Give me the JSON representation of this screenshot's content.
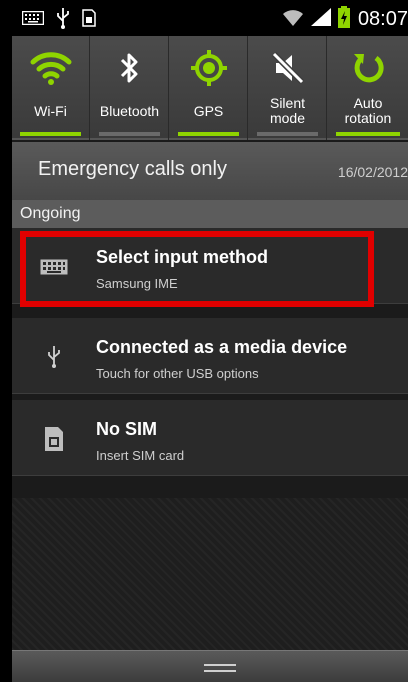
{
  "status_bar": {
    "time": "08:07",
    "left_icons": [
      "keyboard-icon",
      "usb-icon",
      "sim-icon"
    ],
    "right_icons": [
      "wifi-signal-icon",
      "cell-signal-icon",
      "battery-charging-icon"
    ]
  },
  "quick_settings": [
    {
      "label": "Wi-Fi",
      "icon": "wifi-icon",
      "active": true
    },
    {
      "label": "Bluetooth",
      "icon": "bluetooth-icon",
      "active": false
    },
    {
      "label": "GPS",
      "icon": "gps-icon",
      "active": true
    },
    {
      "label": "Silent mode",
      "label_lines": [
        "Silent",
        "mode"
      ],
      "icon": "silent-mode-icon",
      "active": false
    },
    {
      "label": "Auto rotation",
      "label_lines": [
        "Auto",
        "rotation"
      ],
      "icon": "auto-rotation-icon",
      "active": true
    }
  ],
  "emergency": {
    "text": "Emergency calls only",
    "date": "16/02/2012"
  },
  "ongoing_header": "Ongoing",
  "notifications": [
    {
      "title": "Select input method",
      "subtitle": "Samsung IME",
      "icon": "keyboard-icon",
      "highlighted": true
    },
    {
      "title": "Connected as a media device",
      "subtitle": "Touch for other USB options",
      "icon": "usb-icon"
    },
    {
      "title": "No SIM",
      "subtitle": "Insert SIM card",
      "icon": "sim-card-icon"
    }
  ],
  "colors": {
    "accent_on": "#8fd400",
    "highlight_border": "#e00000"
  }
}
